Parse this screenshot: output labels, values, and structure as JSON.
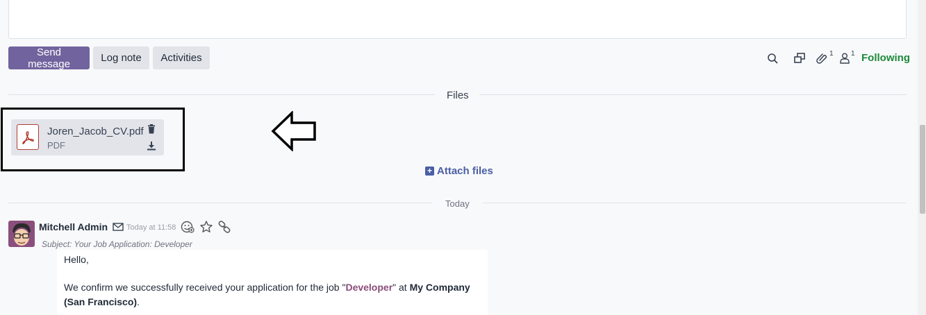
{
  "composer": {
    "send_label": "Send message",
    "log_label": "Log note",
    "activities_label": "Activities"
  },
  "toolbar": {
    "attachments_count": "1",
    "followers_count": "1",
    "following_label": "Following",
    "icons": [
      "search-icon",
      "expand-window-icon",
      "paperclip-icon",
      "follower-icon"
    ]
  },
  "files": {
    "section_label": "Files",
    "attachment": {
      "name": "Joren_Jacob_CV.pdf",
      "type": "PDF"
    },
    "attach_label": "Attach files"
  },
  "date_separator": "Today",
  "message": {
    "author": "Mitchell Admin",
    "time": "Today at 11:58",
    "subject": "Subject: Your Job Application: Developer",
    "greeting": "Hello,",
    "body_pre": "We confirm we successfully received your application for the job \"",
    "job": "Developer",
    "body_mid": "\" at ",
    "company": "My Company (San Francisco)",
    "body_end": "."
  },
  "colors": {
    "primary": "#71639e",
    "following": "#1b8a3b",
    "link": "#4a5fa5",
    "job_link": "#8a4b7a",
    "pdf": "#b23a32"
  }
}
